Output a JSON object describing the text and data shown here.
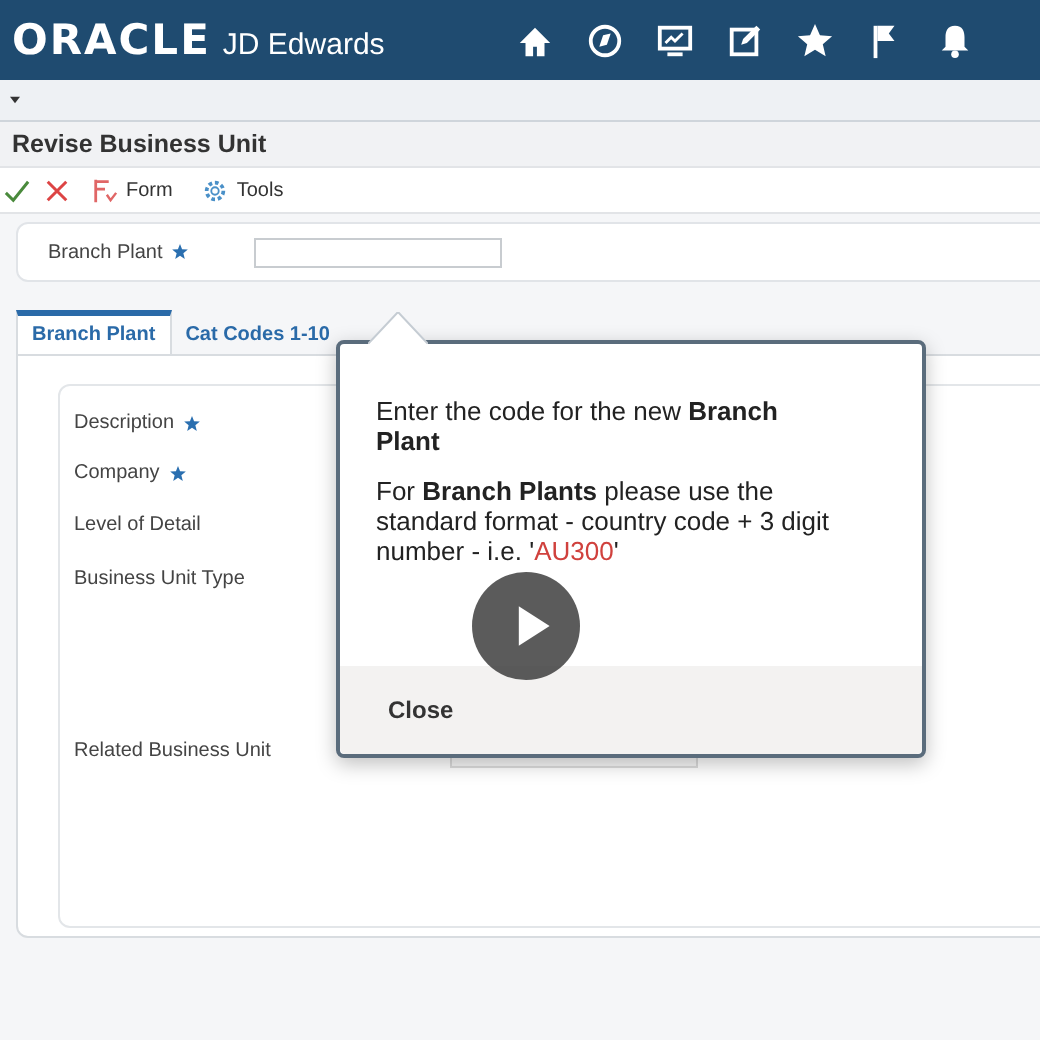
{
  "app_bar": {
    "brand": "ORACLE",
    "product": "JD Edwards"
  },
  "form_title": "Revise Business Unit",
  "toolbar": [
    {
      "kind": "ok"
    },
    {
      "kind": "cancel"
    },
    {
      "kind": "form",
      "label": "Form"
    },
    {
      "kind": "tools",
      "label": "Tools"
    }
  ],
  "header_field": {
    "label": "Branch Plant",
    "required": true
  },
  "tabs": [
    {
      "label": "Branch Plant",
      "selected": true
    },
    {
      "label": "Cat Codes 1-10",
      "selected": false
    }
  ],
  "fields": [
    {
      "label": "Description",
      "required": true,
      "input": false
    },
    {
      "label": "Company",
      "required": true,
      "input": false
    },
    {
      "label": "Level of Detail",
      "required": false,
      "input": false
    },
    {
      "label": "Business Unit Type",
      "required": false,
      "input": false
    },
    {
      "label": "Related Business Unit",
      "required": false,
      "input": true
    }
  ],
  "popup": {
    "heading": "Enter the code for the new **Branch Plant**",
    "body": {
      "text": "For **Branch Plants** please use the standard format - country code + 3 digit number - i.e. '",
      "example": "AU300",
      "after": "'"
    },
    "close": "Close"
  },
  "video": {
    "playing": false
  }
}
